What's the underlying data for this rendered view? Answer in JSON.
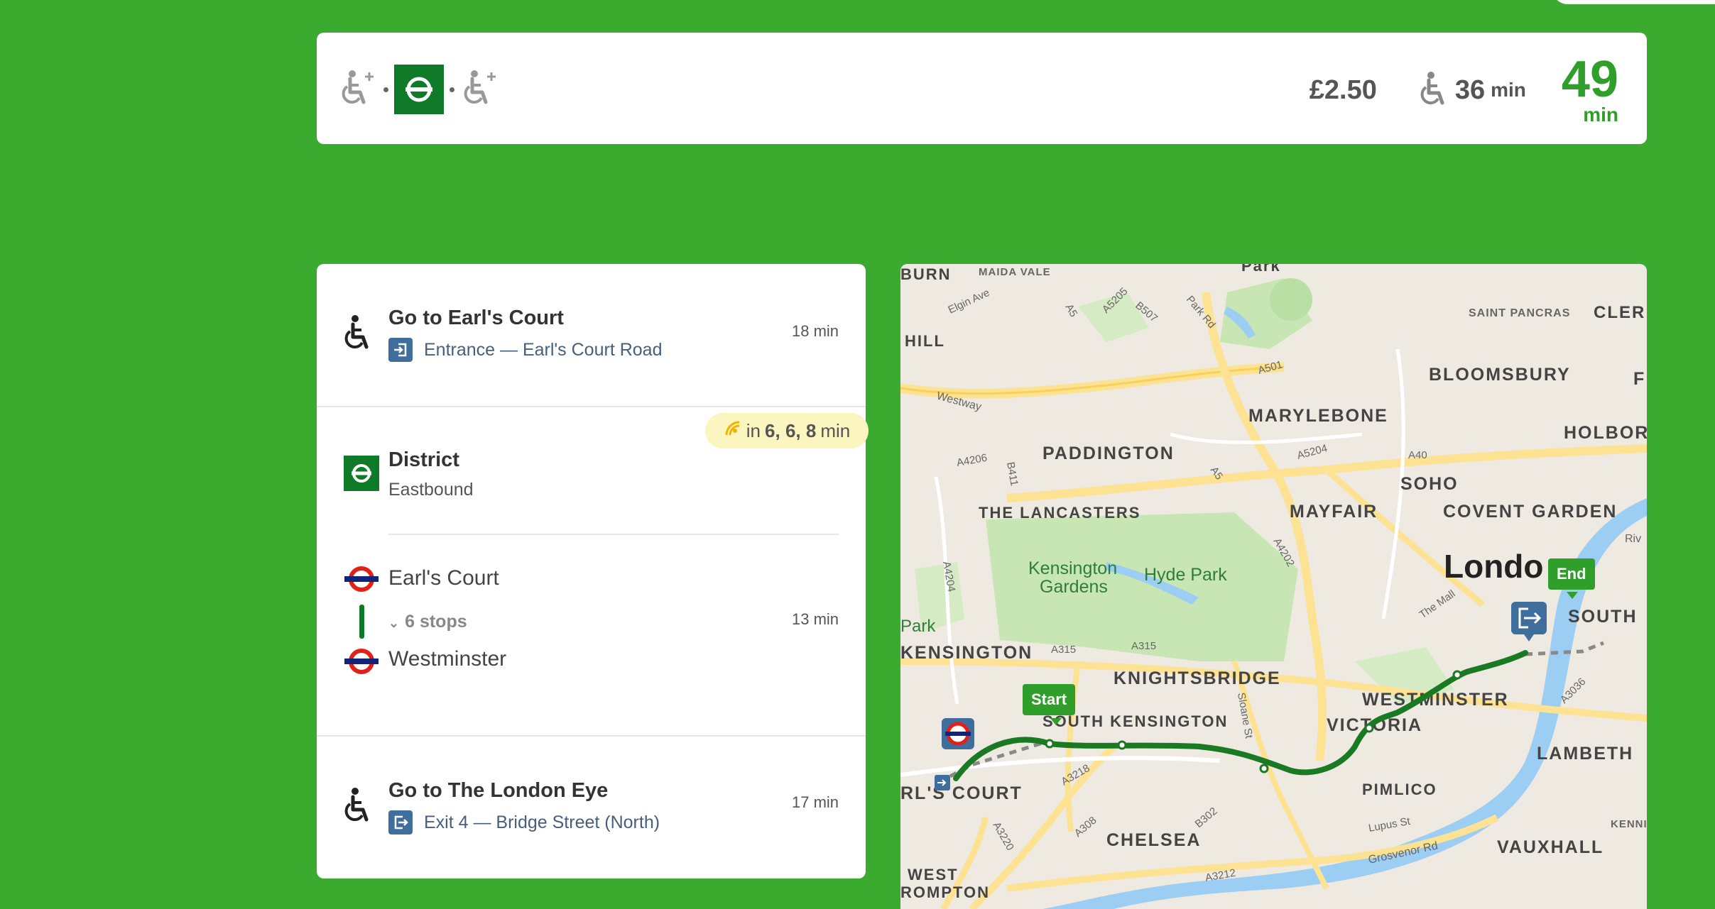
{
  "summary": {
    "line_badge_color": "#0f7a28",
    "fare": "£2.50",
    "walk_time": "36",
    "walk_unit": "min",
    "total_time": "49",
    "total_unit": "min",
    "icons": [
      "wheelchair-plus-icon",
      "underground-roundel-icon",
      "wheelchair-plus-icon"
    ]
  },
  "itinerary": {
    "step1": {
      "title": "Go to Earl's Court",
      "sub": "Entrance — Earl's Court Road",
      "time": "18 min"
    },
    "realtime": {
      "prefix": "in",
      "times": "6, 6, 8",
      "unit": "min"
    },
    "transit": {
      "line": "District",
      "direction": "Eastbound",
      "line_color": "#0f7a28",
      "from": "Earl's Court",
      "stops": "6 stops",
      "to": "Westminster",
      "time": "13 min"
    },
    "step3": {
      "title": "Go to The London Eye",
      "sub": "Exit 4 — Bridge Street (North)",
      "time": "17 min"
    }
  },
  "map": {
    "start_label": "Start",
    "end_label": "End",
    "route_color": "#1a7a24",
    "areas": [
      "BURN",
      "MAIDA VALE",
      "Park",
      "HILL",
      "SAINT PANCRAS",
      "CLER",
      "BLOOMSBURY",
      "F",
      "MARYLEBONE",
      "HOLBOR",
      "PADDINGTON",
      "SOHO",
      "THE LANCASTERS",
      "MAYFAIR",
      "COVENT GARDEN",
      "Londo",
      "SOUTH",
      "Kensington Gardens",
      "Hyde Park",
      "Park",
      "KENSINGTON",
      "KNIGHTSBRIDGE",
      "WESTMINSTER",
      "VICTORIA",
      "LAMBETH",
      "PIMLICO",
      "KENNING",
      "CHELSEA",
      "VAUXHALL",
      "WEST",
      "ROMPTON",
      "RL'S COURT",
      "SOUTH KENSINGTON"
    ],
    "roads": [
      "Elgin Ave",
      "A5",
      "A5205",
      "B507",
      "Park Rd",
      "A501",
      "Westway",
      "A4206",
      "B411",
      "A5204",
      "A40",
      "A5",
      "A4202",
      "A4204",
      "A315",
      "A315",
      "Sloane St",
      "The Mall",
      "A3036",
      "A3218",
      "A308",
      "A3220",
      "B302",
      "A3212",
      "Lupus St",
      "Grosvenor Rd",
      "Riv"
    ]
  }
}
